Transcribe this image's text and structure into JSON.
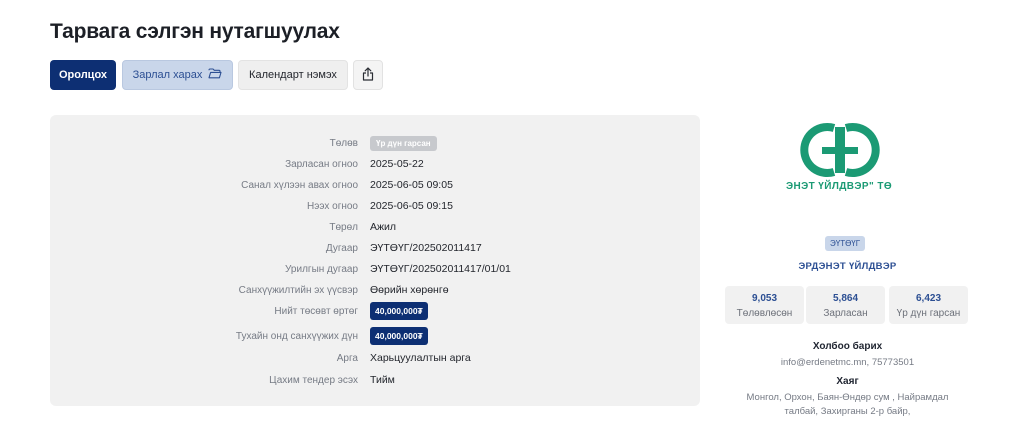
{
  "page": {
    "title": "Тарвага сэлгэн нутагшуулах"
  },
  "actions": {
    "join_label": "Оролцох",
    "docs_label": "Зарлал харах",
    "calendar_label": "Календарт нэмэх"
  },
  "details": [
    {
      "label": "Төлөв",
      "value": "Үр дүн гарсан",
      "style": "badge-gray"
    },
    {
      "label": "Зарласан огноо",
      "value": "2025-05-22"
    },
    {
      "label": "Санал хүлээн авах огноо",
      "value": "2025-06-05 09:05"
    },
    {
      "label": "Нээх огноо",
      "value": "2025-06-05 09:15"
    },
    {
      "label": "Төрөл",
      "value": "Ажил"
    },
    {
      "label": "Дугаар",
      "value": "ЭҮТӨҮГ/202502011417"
    },
    {
      "label": "Урилгын дугаар",
      "value": "ЭҮТӨҮГ/202502011417/01/01"
    },
    {
      "label": "Санхүүжилтийн эх үүсвэр",
      "value": "Өөрийн хөрөнгө"
    },
    {
      "label": "Нийт төсөвт өртөг",
      "value": "40,000,000₮",
      "style": "badge-navy"
    },
    {
      "label": "Тухайн онд санхүүжих дүн",
      "value": "40,000,000₮",
      "style": "badge-navy"
    },
    {
      "label": "Арга",
      "value": "Харьцуулалтын арга"
    },
    {
      "label": "Цахим тендер эсэх",
      "value": "Тийм"
    }
  ],
  "organization": {
    "logo_text": "ЭНЭТ ҮЙЛДВЭР\" ТӨ",
    "tag": "ЭҮТӨҮГ",
    "name": "ЭРДЭНЭТ ҮЙЛДВЭР",
    "brand_color": "#1b9a74",
    "stats": [
      {
        "value": "9,053",
        "label": "Төлөвлөсөн"
      },
      {
        "value": "5,864",
        "label": "Зарласан"
      },
      {
        "value": "6,423",
        "label": "Үр дүн гарсан"
      }
    ],
    "contact_heading": "Холбоо барих",
    "contact_text": "info@erdenetmc.mn, 75773501",
    "address_heading": "Хаяг",
    "address_line1": "Монгол, Орхон, Баян-Өндөр сум , Найрамдал",
    "address_line2": "талбай, Захирганы 2-р байр,"
  },
  "icons": {
    "docs": "folder-open-icon",
    "share": "share-icon"
  },
  "colors": {
    "primary": "#0d2f73",
    "accent": "#2c4f93",
    "panel": "#f1f1f1"
  }
}
